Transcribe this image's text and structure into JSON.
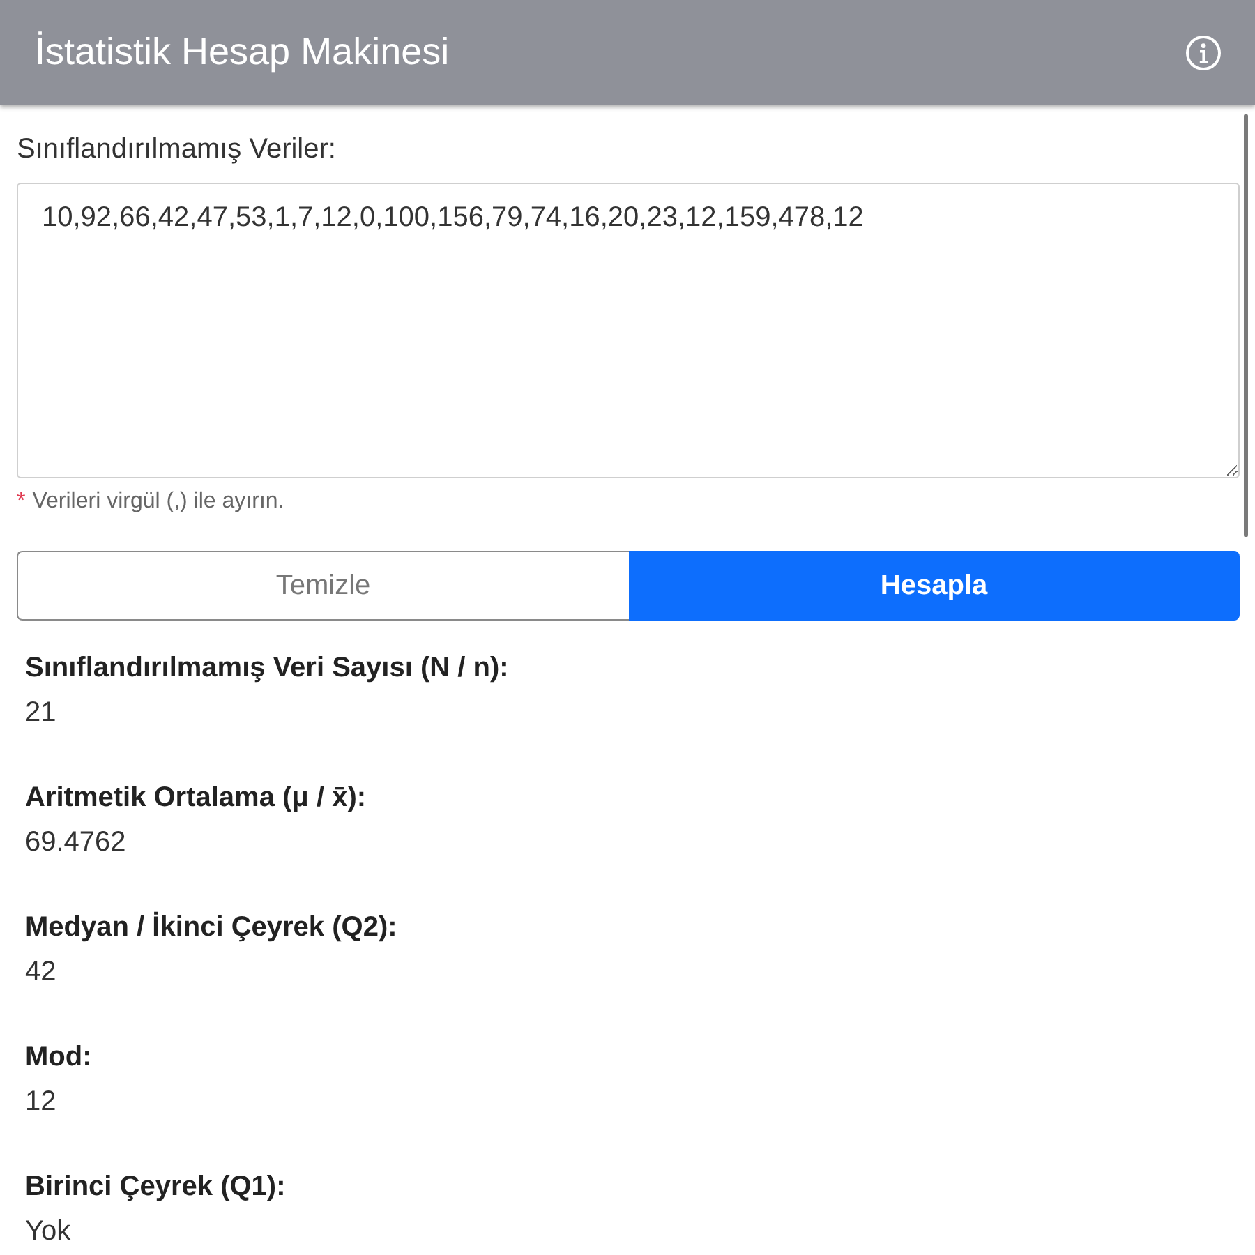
{
  "header": {
    "title": "İstatistik Hesap Makinesi"
  },
  "input": {
    "label": "Sınıflandırılmamış Veriler:",
    "value": "10,92,66,42,47,53,1,7,12,0,100,156,79,74,16,20,23,12,159,478,12",
    "hint_mark": "*",
    "hint": "Verileri virgül (,) ile ayırın."
  },
  "buttons": [
    {
      "label": "Temizle",
      "kind": "secondary"
    },
    {
      "label": "Hesapla",
      "kind": "primary"
    }
  ],
  "results": [
    {
      "label": "Sınıflandırılmamış Veri Sayısı (N / n):",
      "value": "21"
    },
    {
      "label": "Aritmetik Ortalama (μ / x̄):",
      "value": "69.4762"
    },
    {
      "label": "Medyan / İkinci Çeyrek (Q2):",
      "value": "42"
    },
    {
      "label": "Mod:",
      "value": "12"
    },
    {
      "label": "Birinci Çeyrek (Q1):",
      "value": "Yok"
    }
  ]
}
